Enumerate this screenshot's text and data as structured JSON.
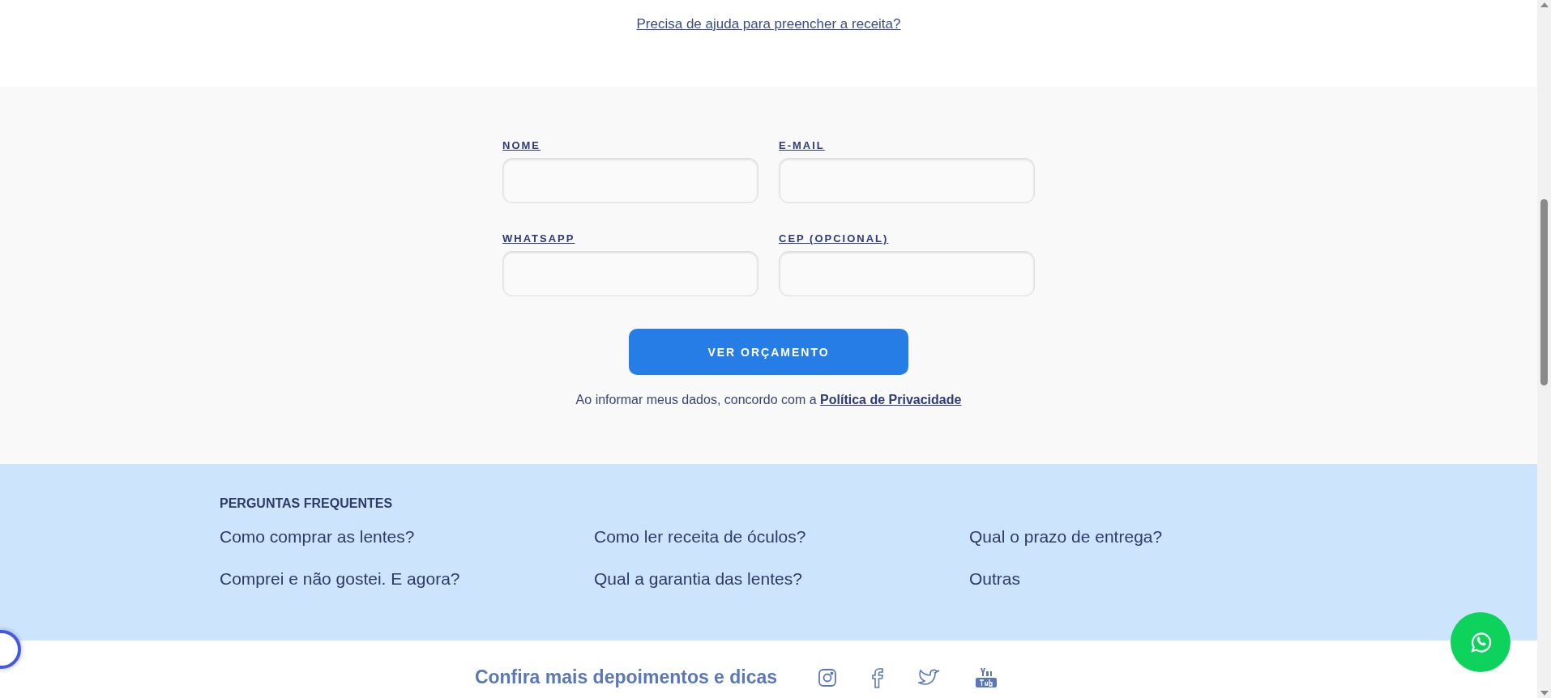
{
  "help_link": "Precisa de ajuda para preencher a receita?",
  "form": {
    "fields": [
      {
        "label": "NOME"
      },
      {
        "label": "E-MAIL"
      },
      {
        "label": "WHATSAPP"
      },
      {
        "label": "CEP (OPCIONAL)"
      }
    ],
    "submit": "VER ORÇAMENTO",
    "consent": {
      "text": "Ao informar meus dados, concordo com a",
      "link": "Política de Privacidade"
    }
  },
  "faq": {
    "title": "PERGUNTAS FREQUENTES",
    "items": [
      "Como comprar as lentes?",
      "Como ler receita de óculos?",
      "Qual o prazo de entrega?",
      "Comprei e não gostei. E agora?",
      "Qual a garantia das lentes?",
      "Outras"
    ]
  },
  "social": {
    "title": "Confira mais depoimentos e dicas",
    "networks": [
      {
        "kind": "instagram"
      },
      {
        "kind": "facebook"
      },
      {
        "kind": "twitter"
      },
      {
        "kind": "youtube"
      }
    ]
  }
}
